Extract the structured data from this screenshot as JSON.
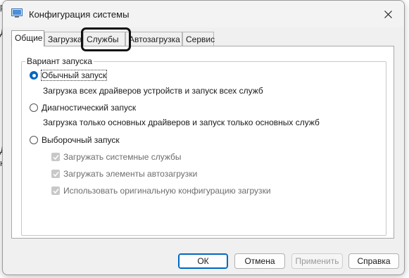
{
  "window": {
    "title": "Конфигурация системы"
  },
  "tabs": [
    {
      "label": "Общие",
      "active": true
    },
    {
      "label": "Загрузка",
      "active": false
    },
    {
      "label": "Службы",
      "active": false
    },
    {
      "label": "Автозагрузка",
      "active": false
    },
    {
      "label": "Сервис",
      "active": false
    }
  ],
  "startup_group": {
    "label": "Вариант запуска",
    "options": [
      {
        "label": "Обычный запуск",
        "description": "Загрузка всех драйверов устройств и запуск всех служб",
        "selected": true
      },
      {
        "label": "Диагностический запуск",
        "description": "Загрузка только основных драйверов и запуск только основных служб",
        "selected": false
      },
      {
        "label": "Выборочный запуск",
        "description": "",
        "selected": false
      }
    ],
    "selective_options": [
      {
        "label": "Загружать системные службы",
        "checked": true,
        "enabled": false
      },
      {
        "label": "Загружать элементы автозагрузки",
        "checked": true,
        "enabled": false
      },
      {
        "label": "Использовать оригинальную конфигурацию загрузки",
        "checked": true,
        "enabled": false
      }
    ]
  },
  "buttons": {
    "ok": "ОК",
    "cancel": "Отмена",
    "apply": "Применить",
    "help": "Справка"
  },
  "background_fragments": [
    "Д",
    "Д",
    "к",
    "р"
  ],
  "colors": {
    "accent": "#0067c0",
    "window_bg": "#f0f0f0",
    "panel_bg": "#ffffff",
    "annotation_box": "#111111"
  }
}
